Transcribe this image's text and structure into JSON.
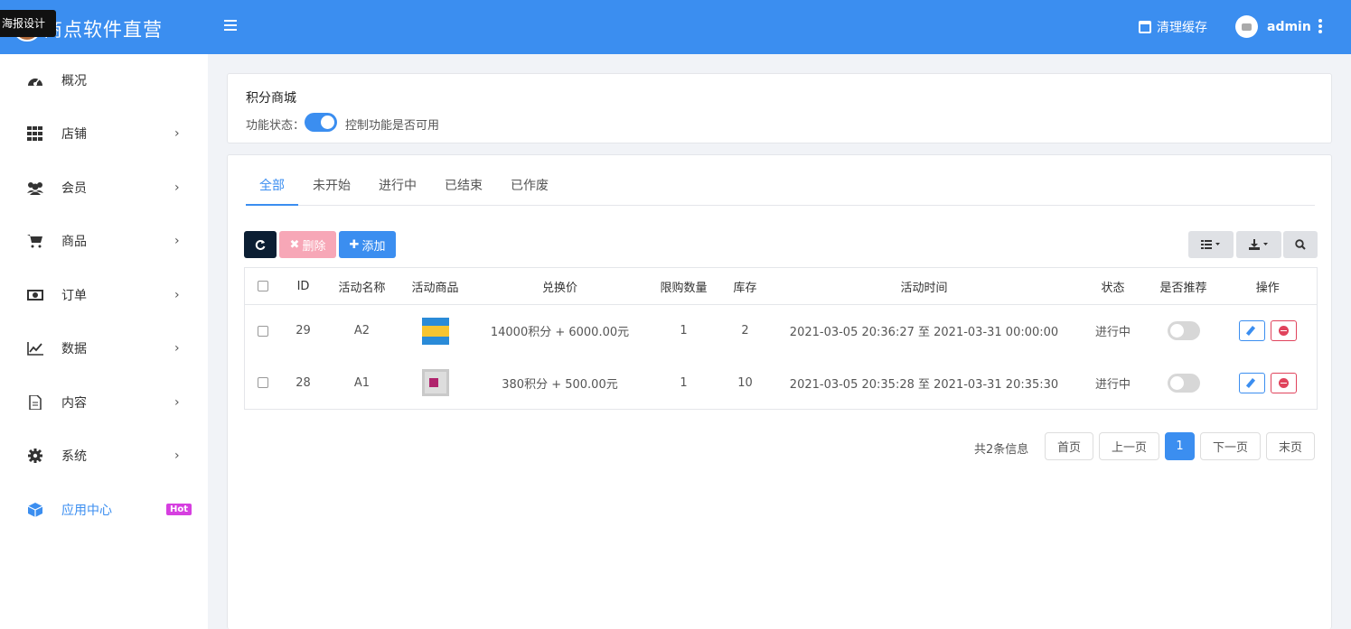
{
  "tooltip": "海报设计",
  "brand": {
    "name": "商点软件直营"
  },
  "topbar": {
    "clear_cache": "清理缓存",
    "username": "admin"
  },
  "sidebar": {
    "items": [
      {
        "label": "概况",
        "icon": "dashboard-icon",
        "has_arrow": false
      },
      {
        "label": "店铺",
        "icon": "grid-icon",
        "has_arrow": true
      },
      {
        "label": "会员",
        "icon": "users-icon",
        "has_arrow": true
      },
      {
        "label": "商品",
        "icon": "cart-icon",
        "has_arrow": true
      },
      {
        "label": "订单",
        "icon": "money-icon",
        "has_arrow": true
      },
      {
        "label": "数据",
        "icon": "chart-line-icon",
        "has_arrow": true
      },
      {
        "label": "内容",
        "icon": "document-icon",
        "has_arrow": true
      },
      {
        "label": "系统",
        "icon": "gear-icon",
        "has_arrow": true
      },
      {
        "label": "应用中心",
        "icon": "cube-icon",
        "badge": "Hot",
        "active": true
      }
    ],
    "arrow": "›"
  },
  "feature": {
    "title": "积分商城",
    "status_label": "功能状态：",
    "enabled": true,
    "status_desc": "控制功能是否可用"
  },
  "tabs": [
    "全部",
    "未开始",
    "进行中",
    "已结束",
    "已作废"
  ],
  "active_tab": 0,
  "toolbar": {
    "delete": "删除",
    "add": "添加"
  },
  "table": {
    "headers": [
      "ID",
      "活动名称",
      "活动商品",
      "兑换价",
      "限购数量",
      "库存",
      "活动时间",
      "状态",
      "是否推荐",
      "操作"
    ],
    "rows": [
      {
        "id": "29",
        "name": "A2",
        "price": "14000积分 + 6000.00元",
        "limit": "1",
        "stock": "2",
        "time": "2021-03-05 20:36:27 至 2021-03-31 00:00:00",
        "status": "进行中",
        "recommended": false
      },
      {
        "id": "28",
        "name": "A1",
        "price": "380积分 + 500.00元",
        "limit": "1",
        "stock": "10",
        "time": "2021-03-05 20:35:28 至 2021-03-31 20:35:30",
        "status": "进行中",
        "recommended": false
      }
    ]
  },
  "pagination": {
    "info": "共2条信息",
    "first": "首页",
    "prev": "上一页",
    "current": "1",
    "next": "下一页",
    "last": "末页"
  },
  "colors": {
    "primary": "#3b8ef0",
    "danger": "#e0435c",
    "hot": "#d63fe0",
    "dark": "#0b1e33"
  }
}
